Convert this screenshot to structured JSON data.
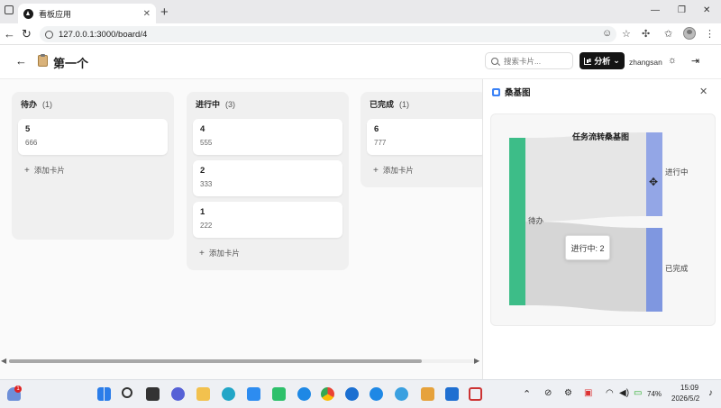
{
  "browser": {
    "tab_title": "看板应用",
    "url": "127.0.0.1:3000/board/4"
  },
  "header": {
    "title": "第一个",
    "search_placeholder": "搜索卡片...",
    "analyze_label": "分析",
    "username": "zhangsan"
  },
  "columns": [
    {
      "name": "待办",
      "count": "(1)",
      "cards": [
        {
          "title": "5",
          "desc": "666"
        }
      ],
      "add_label": "添加卡片"
    },
    {
      "name": "进行中",
      "count": "(3)",
      "cards": [
        {
          "title": "4",
          "desc": "555"
        },
        {
          "title": "2",
          "desc": "333"
        },
        {
          "title": "1",
          "desc": "222"
        }
      ],
      "add_label": "添加卡片"
    },
    {
      "name": "已完成",
      "count": "(1)",
      "cards": [
        {
          "title": "6",
          "desc": "777"
        }
      ],
      "add_label": "添加卡片"
    }
  ],
  "panel": {
    "title": "桑基图",
    "tooltip": "进行中: 2"
  },
  "chart_data": {
    "type": "sankey",
    "title": "任务流转桑基图",
    "nodes": [
      {
        "name": "待办",
        "color": "#3dbd88"
      },
      {
        "name": "进行中",
        "color": "#93a6e6"
      },
      {
        "name": "已完成",
        "color": "#7f97e0"
      }
    ],
    "links": [
      {
        "source": "待办",
        "target": "进行中",
        "value": 2
      },
      {
        "source": "待办",
        "target": "已完成",
        "value": 2
      }
    ]
  },
  "taskbar": {
    "battery": "74%",
    "time": "15:09",
    "date": "2026/5/2",
    "notification_count": "1"
  }
}
